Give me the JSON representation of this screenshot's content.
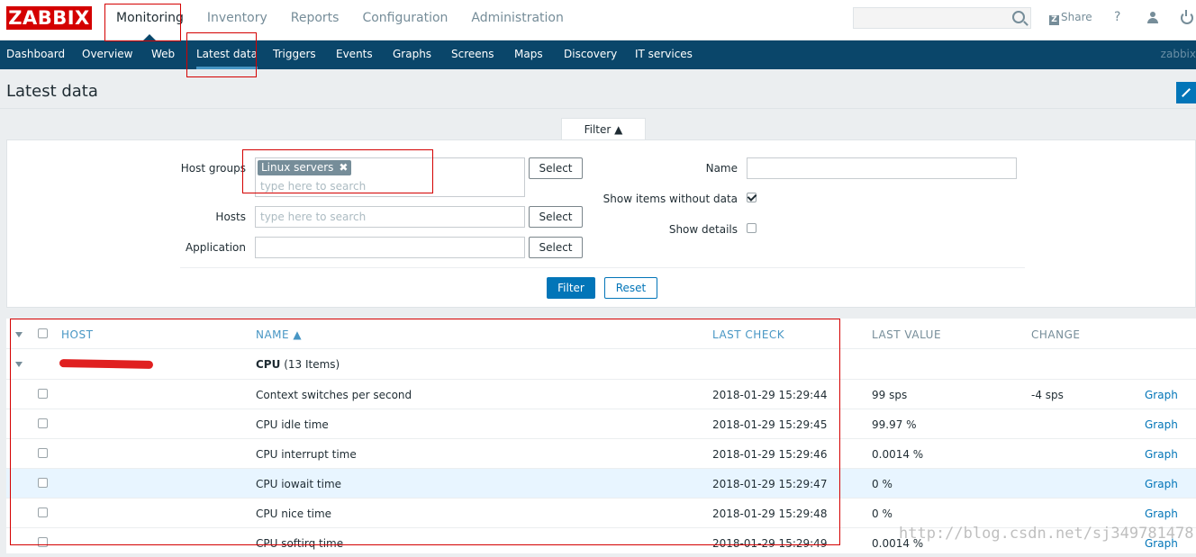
{
  "logo": "ZABBIX",
  "top_menu": [
    "Monitoring",
    "Inventory",
    "Reports",
    "Configuration",
    "Administration"
  ],
  "top_right": {
    "share": "Share",
    "help": "?"
  },
  "sub_menu": [
    "Dashboard",
    "Overview",
    "Web",
    "Latest data",
    "Triggers",
    "Events",
    "Graphs",
    "Screens",
    "Maps",
    "Discovery",
    "IT services"
  ],
  "sub_menu_right": "zabbix",
  "page_title": "Latest data",
  "filter": {
    "tab_label": "Filter ▲",
    "host_groups_label": "Host groups",
    "host_groups_chip": "Linux servers",
    "host_groups_chip_remove": "✖",
    "host_groups_placeholder": "type here to search",
    "hosts_label": "Hosts",
    "hosts_placeholder": "type here to search",
    "application_label": "Application",
    "application_value": "",
    "select_label": "Select",
    "name_label": "Name",
    "name_value": "",
    "show_items_label": "Show items without data",
    "show_items_checked": true,
    "show_details_label": "Show details",
    "show_details_checked": false,
    "filter_button": "Filter",
    "reset_button": "Reset"
  },
  "table": {
    "headers": {
      "host": "HOST",
      "name": "NAME ▲",
      "last_check": "LAST CHECK",
      "last_value": "LAST VALUE",
      "change": "CHANGE"
    },
    "group": {
      "app": "CPU",
      "count": "(13 Items)"
    },
    "rows": [
      {
        "name": "Context switches per second",
        "last_check": "2018-01-29 15:29:44",
        "last_value": "99 sps",
        "change": "-4 sps",
        "action": "Graph"
      },
      {
        "name": "CPU idle time",
        "last_check": "2018-01-29 15:29:45",
        "last_value": "99.97 %",
        "change": "",
        "action": "Graph"
      },
      {
        "name": "CPU interrupt time",
        "last_check": "2018-01-29 15:29:46",
        "last_value": "0.0014 %",
        "change": "",
        "action": "Graph"
      },
      {
        "name": "CPU iowait time",
        "last_check": "2018-01-29 15:29:47",
        "last_value": "0 %",
        "change": "",
        "action": "Graph"
      },
      {
        "name": "CPU nice time",
        "last_check": "2018-01-29 15:29:48",
        "last_value": "0 %",
        "change": "",
        "action": "Graph"
      },
      {
        "name": "CPU softirq time",
        "last_check": "2018-01-29 15:29:49",
        "last_value": "0.0014 %",
        "change": "",
        "action": "Graph"
      }
    ]
  },
  "watermark": "http://blog.csdn.net/sj349781478"
}
